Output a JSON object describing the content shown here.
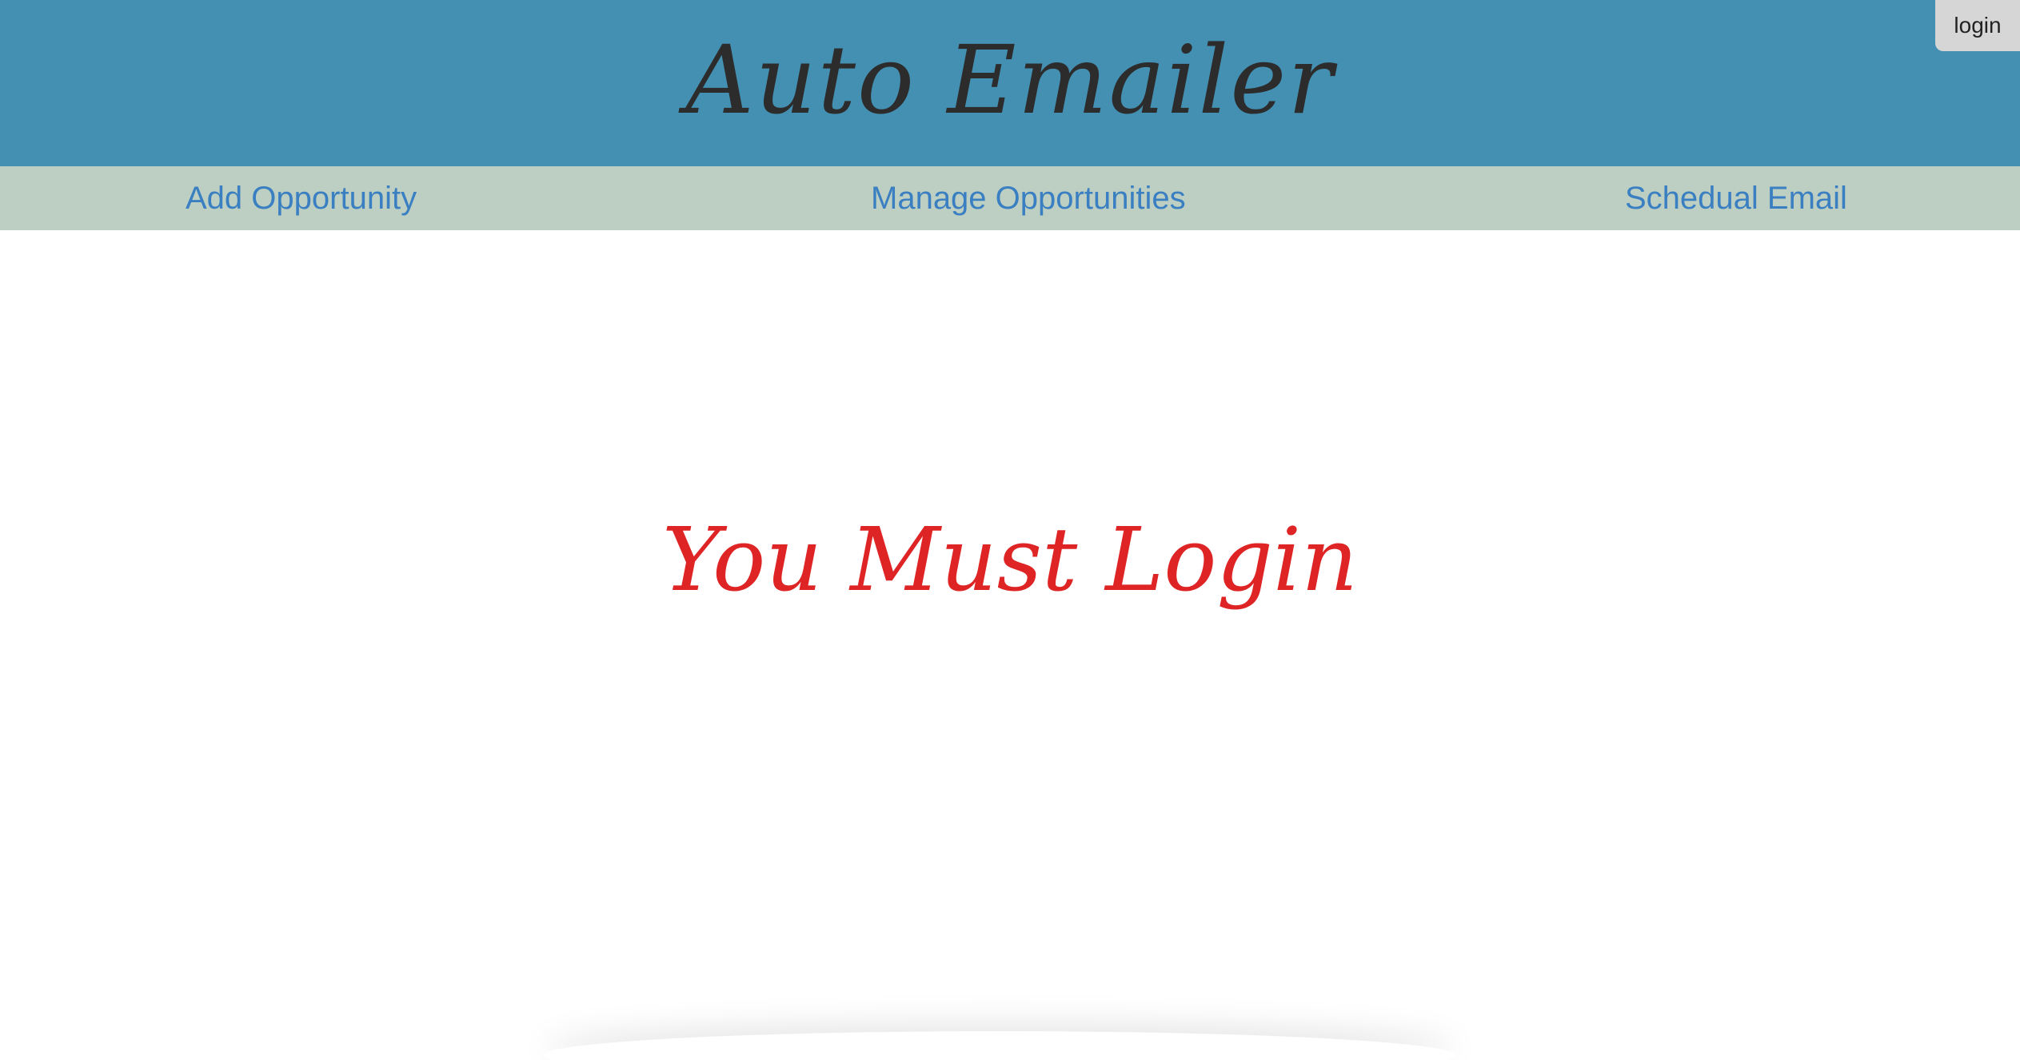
{
  "header": {
    "title": "Auto Emailer",
    "login_label": "login"
  },
  "nav": {
    "items": [
      {
        "label": "Add Opportunity"
      },
      {
        "label": "Manage Opportunities"
      },
      {
        "label": "Schedual Email"
      }
    ]
  },
  "main": {
    "message": "You Must Login"
  },
  "colors": {
    "header_bg": "#4490b3",
    "nav_bg": "#bccfc2",
    "link": "#3a7fc1",
    "message": "#de2424",
    "login_bg": "#d6d6d6"
  }
}
